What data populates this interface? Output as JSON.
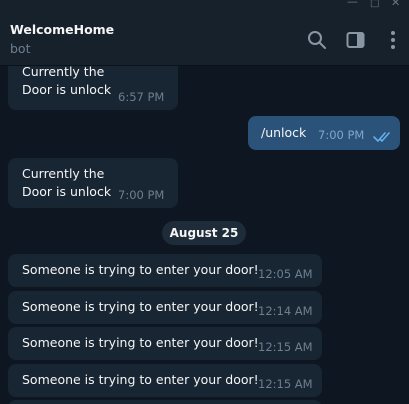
{
  "app": {
    "chat_title": "WelcomeHome",
    "chat_status": "bot"
  },
  "header_icons": [
    "search-icon",
    "sidebar-toggle-icon",
    "more-vertical-icon"
  ],
  "window_controls": [
    "minimize-icon",
    "maximize-icon",
    "close-icon"
  ],
  "messages": [
    {
      "direction": "in",
      "line1": "Currently the",
      "line2": "Door is unlock",
      "time": "6:57 PM"
    },
    {
      "direction": "out",
      "text": "/unlock",
      "time": "7:00 PM",
      "read": true
    },
    {
      "direction": "in",
      "line1": "Currently the",
      "line2": "Door is unlock",
      "time": "7:00 PM"
    },
    {
      "direction": "in",
      "text": "Someone is trying to enter your door!",
      "time": "12:05 AM"
    },
    {
      "direction": "in",
      "text": "Someone is trying to enter your door!",
      "time": "12:14 AM"
    },
    {
      "direction": "in",
      "text": "Someone is trying to enter your door!",
      "time": "12:15 AM"
    },
    {
      "direction": "in",
      "text": "Someone is trying to enter your door!",
      "time": "12:15 AM"
    }
  ],
  "date_separator": "August 25",
  "colors": {
    "background": "#0e1621",
    "header": "#17212b",
    "incoming_bubble": "#182533",
    "outgoing_bubble": "#2b5278",
    "read_check": "#5fb0ee"
  }
}
